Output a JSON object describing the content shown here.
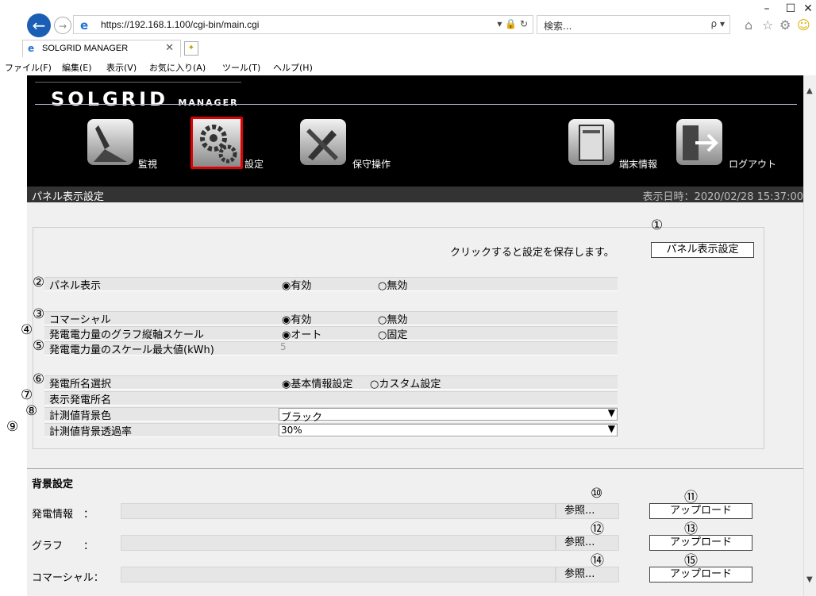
{
  "window": {
    "minimize": "–",
    "maximize": "☐",
    "close": "✕"
  },
  "browser": {
    "url": "https://192.168.1.100/cgi-bin/main.cgi",
    "address_tools": "▾ 🔒 ↻",
    "search_placeholder": "検索...",
    "search_tools": "ρ ▾",
    "tab_title": "SOLGRID MANAGER",
    "tab_close": "✕",
    "menu": [
      "ファイル(F)",
      "編集(E)",
      "表示(V)",
      "お気に入り(A)",
      "ツール(T)",
      "ヘルプ(H)"
    ]
  },
  "app": {
    "logo_main": "SOLGRID",
    "logo_sub": "MANAGER",
    "nav": [
      {
        "label": "監視",
        "icon": "monitor-icon"
      },
      {
        "label": "設定",
        "icon": "gear-icon"
      },
      {
        "label": "保守操作",
        "icon": "tools-icon"
      },
      {
        "label": "端末情報",
        "icon": "device-icon"
      },
      {
        "label": "ログアウト",
        "icon": "logout-icon"
      }
    ],
    "page_title": "パネル表示設定",
    "datetime": "表示日時：2020/02/28 15:37:00"
  },
  "panel": {
    "save_hint": "クリックすると設定を保存します。",
    "save_button": "パネル表示設定",
    "rows": {
      "panel_display": {
        "label": "パネル表示",
        "opt1": "◉有効",
        "opt2": "○無効"
      },
      "commercial": {
        "label": "コマーシャル",
        "opt1": "◉有効",
        "opt2": "○無効"
      },
      "graph_scale": {
        "label": "発電電力量のグラフ縦軸スケール",
        "opt1": "◉オート",
        "opt2": "○固定"
      },
      "scale_max": {
        "label": "発電電力量のスケール最大値(kWh)",
        "value": "5"
      },
      "site_select": {
        "label": "発電所名選択",
        "opt1": "◉基本情報設定",
        "opt2": "○カスタム設定"
      },
      "site_name": {
        "label": "表示発電所名",
        "value": ""
      },
      "bg_color": {
        "label": "計測値背景色",
        "value": "ブラック"
      },
      "bg_alpha": {
        "label": "計測値背景透過率",
        "value": "30%"
      }
    },
    "markers": [
      "①",
      "②",
      "③",
      "④",
      "⑤",
      "⑥",
      "⑦",
      "⑧",
      "⑨",
      "⑩",
      "⑪",
      "⑫",
      "⑬",
      "⑭",
      "⑮"
    ]
  },
  "background": {
    "heading": "背景設定",
    "rows": [
      {
        "label": "発電情報　：",
        "browse": "参照...",
        "upload": "アップロード"
      },
      {
        "label": "グラフ　　：",
        "browse": "参照...",
        "upload": "アップロード"
      },
      {
        "label": "コマーシャル：",
        "browse": "参照...",
        "upload": "アップロード"
      }
    ]
  }
}
